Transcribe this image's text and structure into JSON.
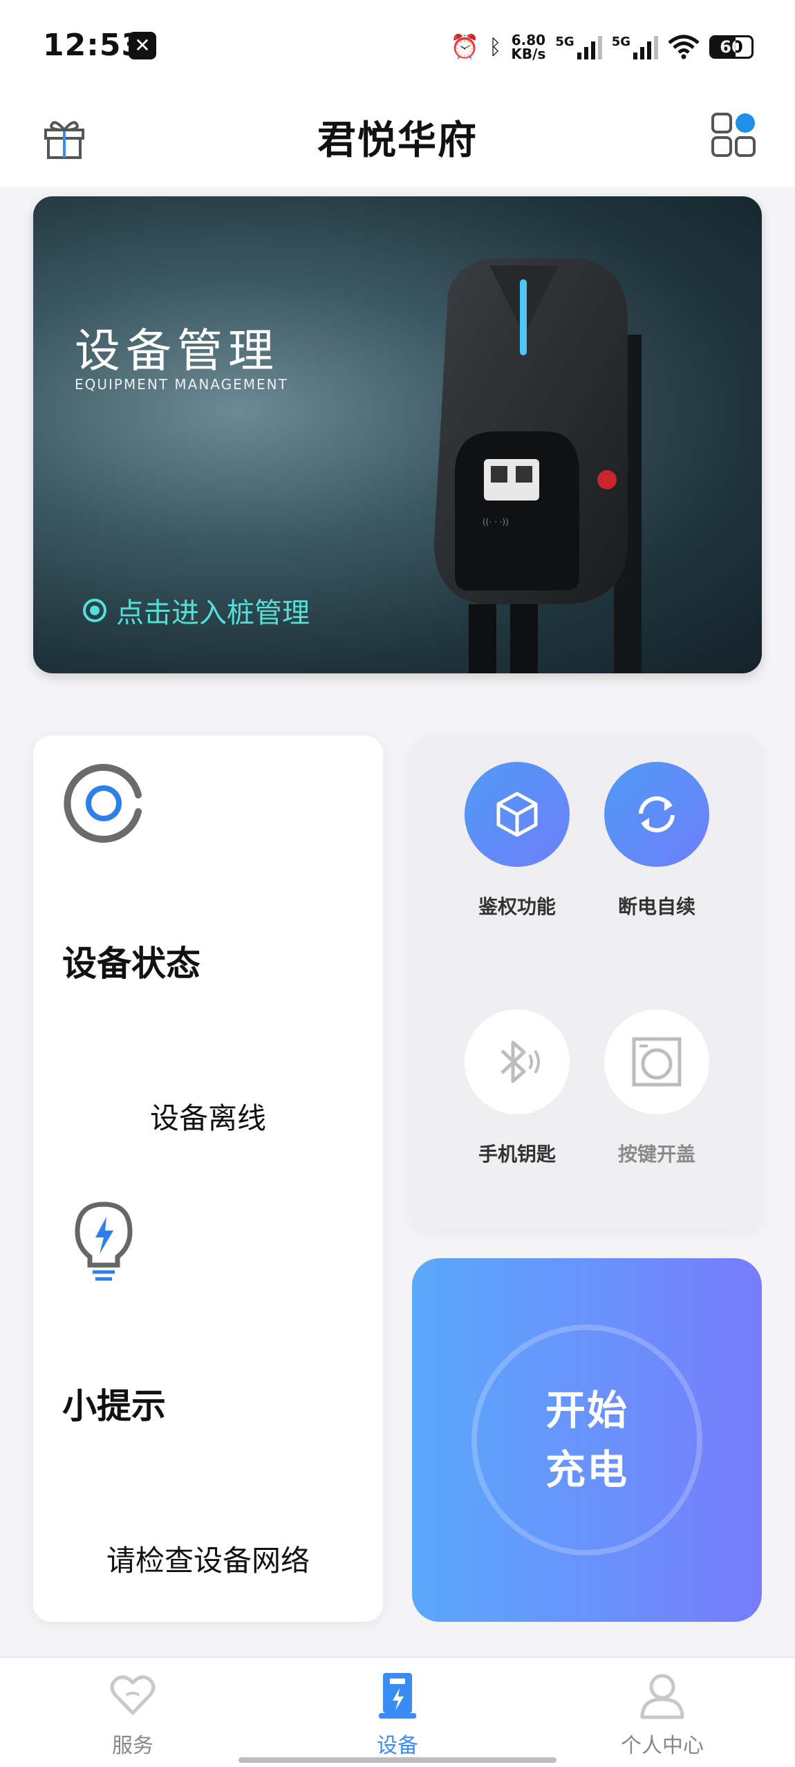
{
  "status_bar": {
    "time": "12:53",
    "speed_value": "6.80",
    "speed_unit": "KB/s",
    "network_1": "5G",
    "network_2": "5G",
    "battery": "60",
    "battery_level_pct": 60
  },
  "header": {
    "title": "君悦华府",
    "left_icon": "gift-icon",
    "right_icon": "grid-icon"
  },
  "banner": {
    "title": "设备管理",
    "subtitle": "EQUIPMENT MANAGEMENT",
    "link": "点击进入桩管理",
    "accent_color": "#52e0d8"
  },
  "status_card": {
    "status_title": "设备状态",
    "status_value": "设备离线",
    "tip_title": "小提示",
    "tip_value": "请检查设备网络"
  },
  "features": [
    {
      "label": "鉴权功能",
      "icon": "cube-icon",
      "enabled": true
    },
    {
      "label": "断电自续",
      "icon": "refresh-icon",
      "enabled": true
    },
    {
      "label": "手机钥匙",
      "icon": "bluetooth-icon",
      "enabled": false
    },
    {
      "label": "按键开盖",
      "icon": "washer-icon",
      "enabled": false
    }
  ],
  "start_button": {
    "line1": "开始",
    "line2": "充电"
  },
  "bottom_nav": [
    {
      "label": "服务",
      "icon": "heart-icon",
      "active": false
    },
    {
      "label": "设备",
      "icon": "charger-icon",
      "active": true
    },
    {
      "label": "个人中心",
      "icon": "person-icon",
      "active": false
    }
  ],
  "colors": {
    "primary": "#3a8cf4",
    "gradient_start": "#5aa8fb",
    "gradient_end": "#777cfb"
  }
}
